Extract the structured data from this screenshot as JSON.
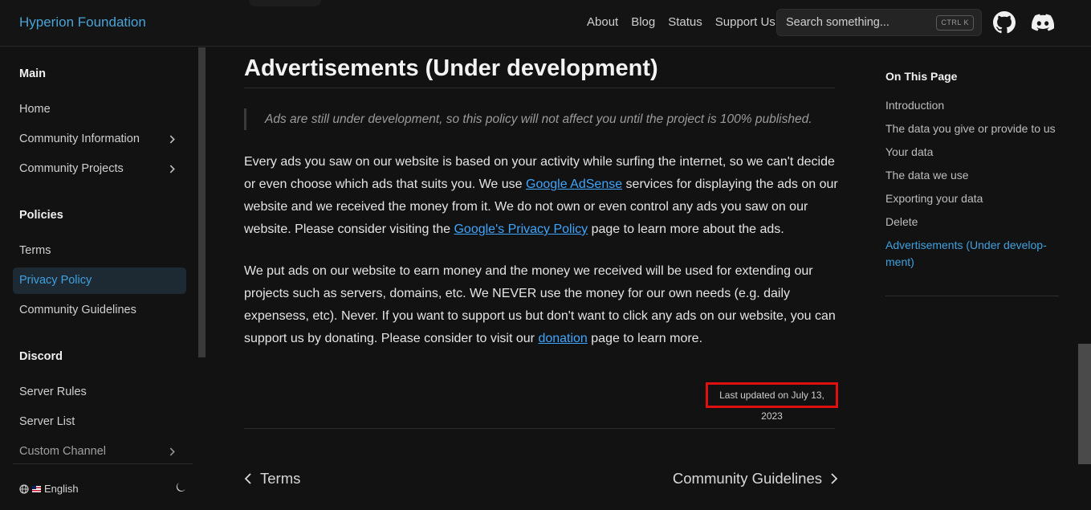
{
  "navbar": {
    "brand": "Hyperion Foundation",
    "links": [
      "About",
      "Blog",
      "Status",
      "Support Us"
    ],
    "search_placeholder": "Search something...",
    "search_shortcut": "CTRL K"
  },
  "sidebar": {
    "groups": [
      {
        "title": "Main",
        "items": [
          {
            "label": "Home",
            "expandable": false
          },
          {
            "label": "Community Information",
            "expandable": true
          },
          {
            "label": "Community Projects",
            "expandable": true
          }
        ]
      },
      {
        "title": "Policies",
        "items": [
          {
            "label": "Terms",
            "expandable": false
          },
          {
            "label": "Privacy Policy",
            "expandable": false,
            "active": true
          },
          {
            "label": "Community Guidelines",
            "expandable": false
          }
        ]
      },
      {
        "title": "Discord",
        "items": [
          {
            "label": "Server Rules",
            "expandable": false
          },
          {
            "label": "Server List",
            "expandable": false
          },
          {
            "label": "Custom Channel",
            "expandable": true
          }
        ]
      }
    ],
    "language": "English"
  },
  "content": {
    "heading": "Advertisements (Under development)",
    "note": "Ads are still under development, so this policy will not affect you until the project is 100% published.",
    "para1": {
      "t1": "Every ads you saw on our website is based on your activity while surfing the internet, so we can't decide or even choose which ads that suits you. We use ",
      "link1": "Google AdSense",
      "t2": " services for displaying the ads on our website and we received the money from it. We do not own or even control any ads you saw on our website. Please consider visiting the ",
      "link2": "Google's Privacy Policy",
      "t3": " page to learn more about the ads."
    },
    "para2": {
      "t1": "We put ads on our website to earn money and the money we received will be used for extending our projects such as servers, domains, etc. We NEVER use the money for our own needs (e.g. daily expensess, etc). Never. If you want to support us but don't want to click any ads on our website, you can support us by donating. Please consider to visit our ",
      "link": "donation",
      "t2": " page to learn more."
    },
    "last_updated": "Last updated on July 13, 2023",
    "prev": "Terms",
    "next": "Community Guidelines"
  },
  "toc": {
    "title": "On This Page",
    "items": [
      "Introduction",
      "The data you give or provide to us",
      "Your data",
      "The data we use",
      "Exporting your data",
      "Delete"
    ],
    "active_item": "Advertisements (Under develop-ment)"
  },
  "colors": {
    "accent": "#3fa1e0",
    "link": "#3ea6ff",
    "highlight_box": "#e01010",
    "background": "#121212"
  }
}
